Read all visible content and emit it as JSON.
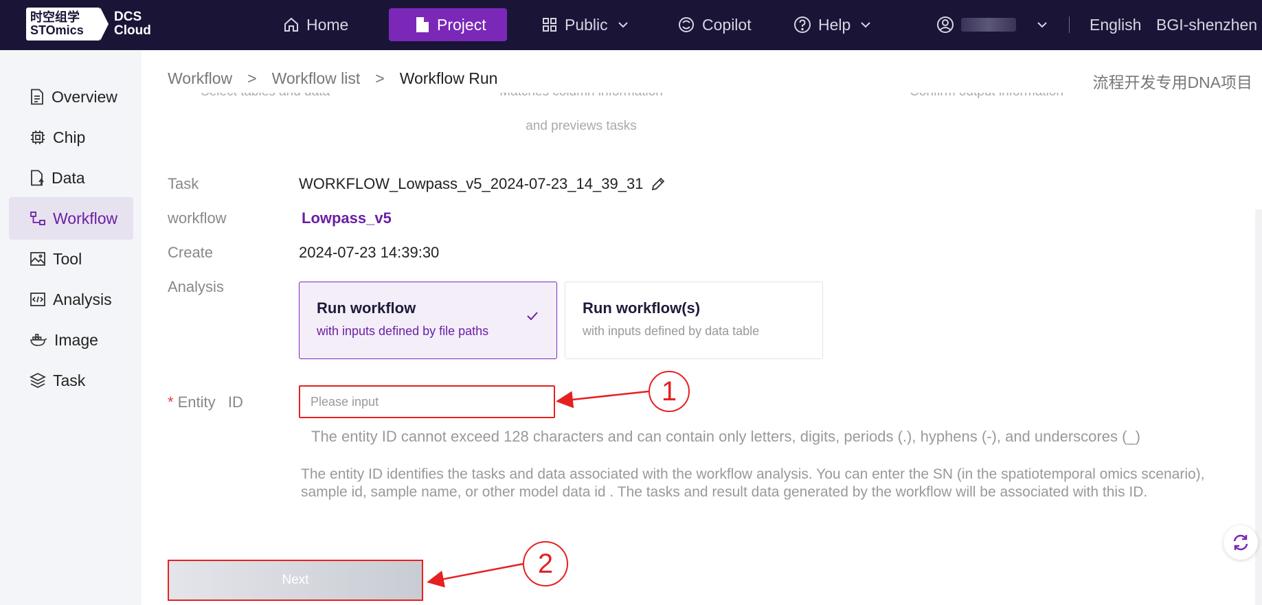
{
  "brand": {
    "logo_cn": "时空组学",
    "logo_en": "STOmics",
    "product_line1": "DCS",
    "product_line2": "Cloud"
  },
  "topnav": {
    "home": "Home",
    "project": "Project",
    "public": "Public",
    "copilot": "Copilot",
    "help": "Help",
    "language": "English",
    "org": "BGI-shenzhen"
  },
  "sidebar": {
    "items": [
      {
        "label": "Overview",
        "icon": "document-icon"
      },
      {
        "label": "Chip",
        "icon": "chip-icon"
      },
      {
        "label": "Data",
        "icon": "file-upload-icon"
      },
      {
        "label": "Workflow",
        "icon": "workflow-icon"
      },
      {
        "label": "Tool",
        "icon": "image-icon"
      },
      {
        "label": "Analysis",
        "icon": "code-icon"
      },
      {
        "label": "Image",
        "icon": "docker-icon"
      },
      {
        "label": "Task",
        "icon": "layers-icon"
      }
    ],
    "active": "Workflow"
  },
  "breadcrumb": {
    "items": [
      "Workflow",
      "Workflow list",
      "Workflow Run"
    ],
    "separator": ">"
  },
  "project_name": "流程开发专用DNA项目",
  "steps": {
    "step1_partial": "Select tables and data",
    "step2_partial_line1": "Matches column information",
    "step2_line2": "and previews tasks",
    "step3_partial": "Confirm output information"
  },
  "form": {
    "task_label": "Task",
    "task_value": "WORKFLOW_Lowpass_v5_2024-07-23_14_39_31",
    "workflow_label": "workflow",
    "workflow_value": "Lowpass_v5",
    "create_label": "Create",
    "create_value": "2024-07-23 14:39:30",
    "analysis_label": "Analysis",
    "cards": [
      {
        "title": "Run workflow",
        "subtitle": "with inputs defined by file paths",
        "selected": true
      },
      {
        "title": "Run workflow(s)",
        "subtitle": "with inputs defined by data table",
        "selected": false
      }
    ],
    "entity_star": "*",
    "entity_label": "Entity   ID",
    "entity_placeholder": "Please input",
    "entity_value": "",
    "entity_hint": "The entity ID cannot exceed 128 characters and can contain only letters, digits, periods (.), hyphens (-), and underscores (_)",
    "entity_desc": "The entity ID identifies the tasks and data associated with the workflow analysis. You can enter the SN (in the spatiotemporal omics scenario), sample id, sample name, or other model data id . The tasks and result data generated by the workflow will be associated with this ID."
  },
  "next_button": "Next",
  "annotations": {
    "marker1": "1",
    "marker2": "2",
    "color": "#e62020"
  },
  "colors": {
    "topbar": "#1a1537",
    "accent": "#7b28b9",
    "accent_text": "#6a1fa3"
  }
}
